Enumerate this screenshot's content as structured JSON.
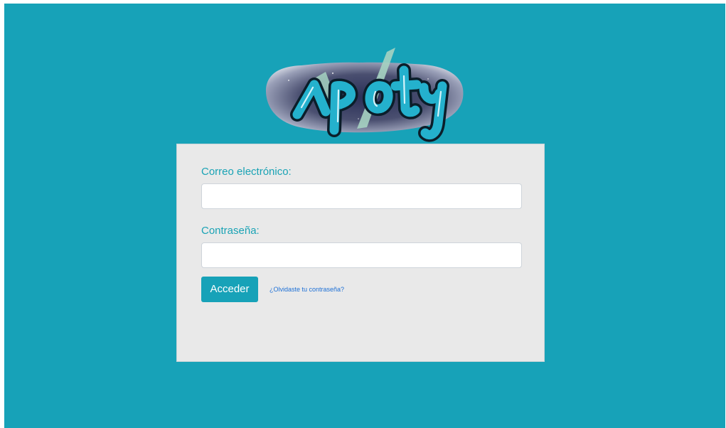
{
  "logo": {
    "text": "apoty",
    "icon": "apoty-logo-icon"
  },
  "form": {
    "email_label": "Correo electrónico:",
    "email_value": "",
    "email_placeholder": "",
    "password_label": "Contraseña:",
    "password_value": "",
    "password_placeholder": "",
    "submit_label": "Acceder",
    "forgot_password_link": "¿Olvidaste tu contraseña?"
  },
  "colors": {
    "background": "#17a2b8",
    "card_background": "#e9e9e9",
    "accent": "#17a2b8",
    "label_text": "#1aa3b5",
    "link": "#1d70d6"
  }
}
